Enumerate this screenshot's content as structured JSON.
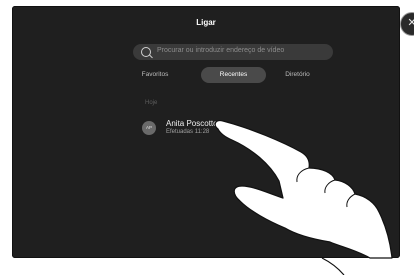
{
  "window": {
    "title": "Ligar"
  },
  "close": {
    "glyph": "✕"
  },
  "search": {
    "placeholder": "Procurar ou introduzir endereço de vídeo"
  },
  "tabs": [
    {
      "label": "Favoritos",
      "active": false
    },
    {
      "label": "Recentes",
      "active": true
    },
    {
      "label": "Diretório",
      "active": false
    }
  ],
  "section": {
    "label": "Hoje"
  },
  "recent_calls": [
    {
      "avatar_initials": "AP",
      "name": "Anita Poscotto",
      "detail": "Efetuadas 11:28"
    }
  ],
  "colors": {
    "background": "#1f1f1f",
    "active_tab": "#4a4a4a",
    "text": "#ffffff"
  }
}
